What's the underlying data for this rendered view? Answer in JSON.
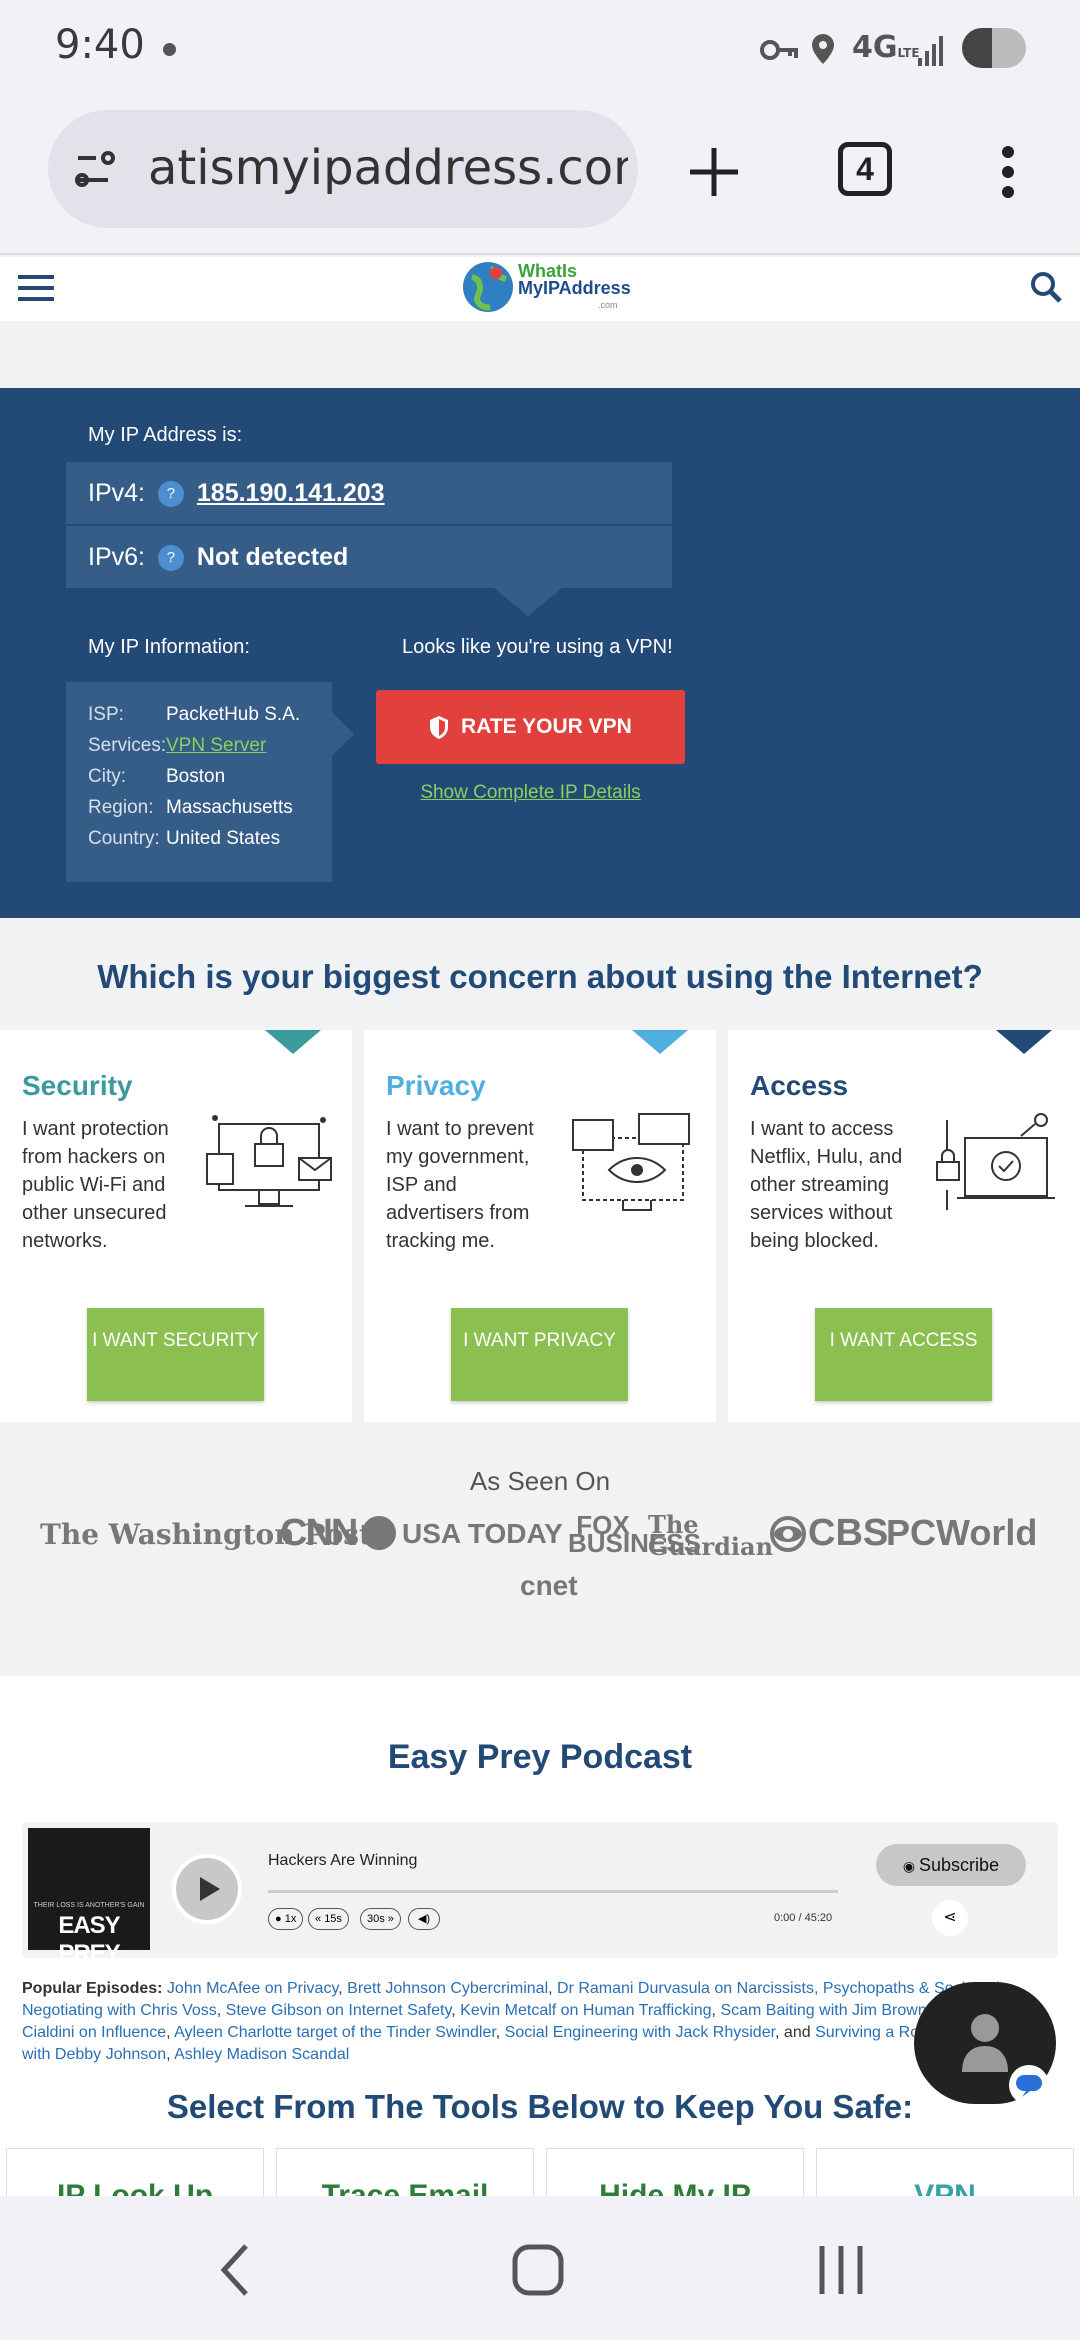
{
  "status": {
    "time": "9:40",
    "network": "4G LTE"
  },
  "browser": {
    "url": "atismyipaddress.com",
    "tab_count": "4"
  },
  "site": {
    "logo_line1": "WhatIs",
    "logo_line2": "MyIPAddress",
    "logo_line3": ".com"
  },
  "ip": {
    "heading": "My IP Address is:",
    "ipv4_label": "IPv4:",
    "ipv4_value": "185.190.141.203",
    "ipv6_label": "IPv6:",
    "ipv6_value": "Not detected",
    "qmark": "?",
    "info_heading": "My IP Information:",
    "vpn_notice": "Looks like you're using a VPN!",
    "rows": [
      {
        "k": "ISP:",
        "v": "PacketHub S.A."
      },
      {
        "k": "Services:",
        "v": "VPN Server"
      },
      {
        "k": "City:",
        "v": "Boston"
      },
      {
        "k": "Region:",
        "v": "Massachusetts"
      },
      {
        "k": "Country:",
        "v": "United States"
      }
    ],
    "rate_button": "RATE YOUR VPN",
    "details_link": "Show Complete IP Details"
  },
  "concern": {
    "title": "Which is your biggest concern about using the Internet?",
    "cards": [
      {
        "title": "Security",
        "text": "I want protection from hackers on public Wi-Fi and other unsecured networks.",
        "button": "I WANT SECURITY",
        "color": "#3a9a9e"
      },
      {
        "title": "Privacy",
        "text": "I want to prevent my government, ISP and advertisers from tracking me.",
        "button": "I WANT PRIVACY",
        "color": "#4fb0e0"
      },
      {
        "title": "Access",
        "text": "I want to access Netflix, Hulu, and other streaming services without being blocked.",
        "button": "I WANT ACCESS",
        "color": "#234a77"
      }
    ]
  },
  "as_seen_on": {
    "title": "As Seen On",
    "outlets": [
      "The Washington Post",
      "CNN",
      "USA TODAY",
      "FOX BUSINESS",
      "The Guardian",
      "CBS",
      "PCWorld",
      "cnet"
    ]
  },
  "podcast": {
    "title": "Easy Prey Podcast",
    "cover_tagline": "THEIR LOSS IS ANOTHER'S GAIN",
    "cover_brand": "EASY PREY",
    "episode": "Hackers Are Winning",
    "speed": "1x",
    "back": "15s",
    "forward": "30s",
    "time": "0:00",
    "duration": "45:20",
    "progress": 0,
    "subscribe": "Subscribe",
    "popular_label": "Popular Episodes:",
    "popular": [
      "John McAfee on Privacy",
      "Brett Johnson Cybercriminal",
      "Dr Ramani Durvasula on Narcissists, Psychopaths & Sociopaths",
      "Negotiating with Chris Voss",
      "Steve Gibson on Internet Safety",
      "Kevin Metcalf on Human Trafficking",
      "Scam Baiting with Jim Browning",
      "Robert Cialdini on Influence",
      "Ayleen Charlotte target of the Tinder Swindler",
      "Social Engineering with Jack Rhysider",
      "Surviving a Romance Scam with Debby Johnson",
      "Ashley Madison Scandal"
    ],
    "and_word": "and"
  },
  "tools": {
    "title": "Select From The Tools Below to Keep You Safe:",
    "cards": [
      "IP Look Up",
      "Trace Email",
      "Hide My IP",
      "VPN"
    ]
  }
}
